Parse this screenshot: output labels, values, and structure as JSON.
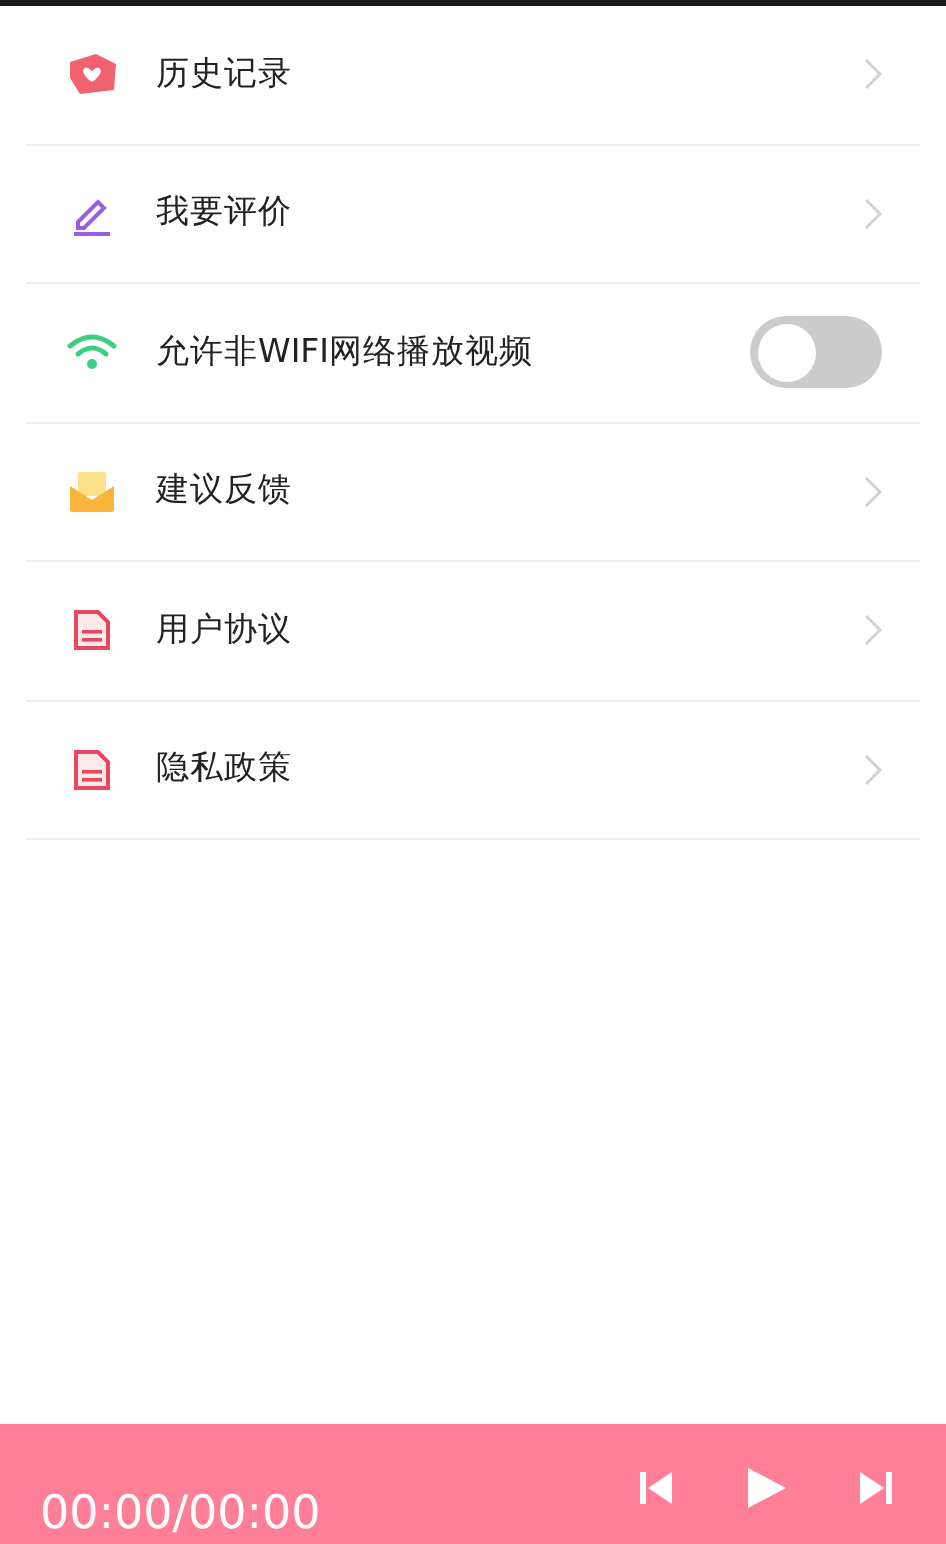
{
  "menu": [
    {
      "kind": "link",
      "label": "历史记录"
    },
    {
      "kind": "link",
      "label": "我要评价"
    },
    {
      "kind": "toggle",
      "label": "允许非WIFI网络播放视频",
      "on": false
    },
    {
      "kind": "link",
      "label": "建议反馈"
    },
    {
      "kind": "link",
      "label": "用户协议"
    },
    {
      "kind": "link",
      "label": "隐私政策"
    }
  ],
  "player": {
    "time": "00:00/00:00"
  }
}
